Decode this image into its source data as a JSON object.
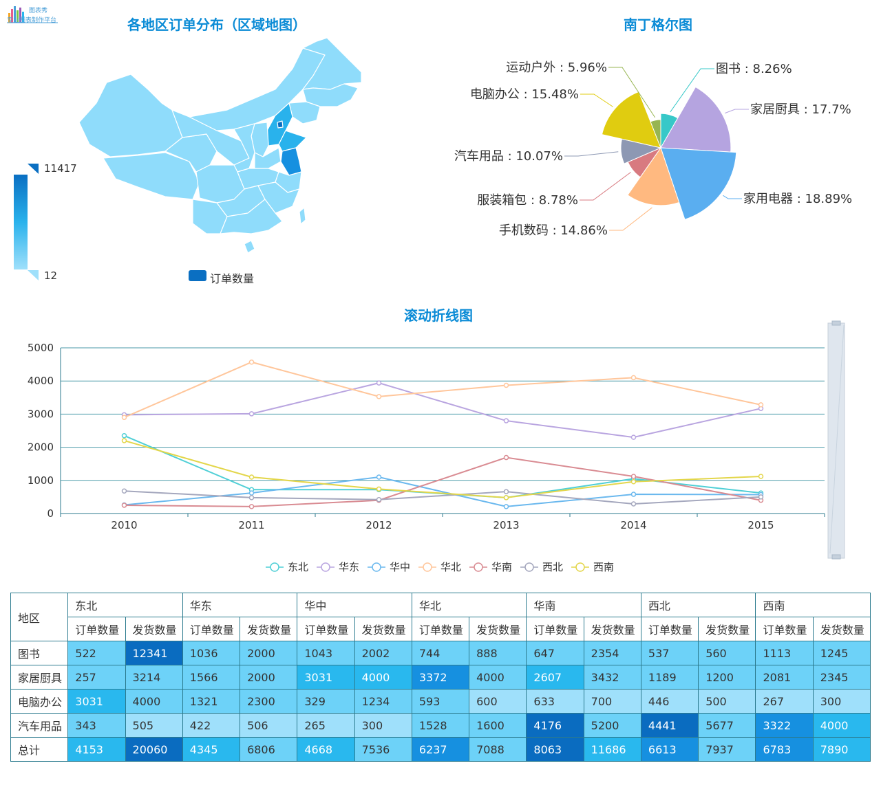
{
  "logo": {
    "brand": "图表秀",
    "tagline": "专业图表制作平台"
  },
  "map": {
    "title": "各地区订单分布（区域地图）",
    "legend_max": "11417",
    "legend_min": "12",
    "legend_label": "订单数量",
    "colors": {
      "light": "#8fdcfb",
      "mid": "#29b2ec",
      "dark": "#0a6fc2"
    }
  },
  "pie": {
    "title": "南丁格尔图",
    "slices": [
      {
        "name": "图书",
        "percent": 8.26,
        "label": "图书 : 8.26%",
        "color": "#37c8c8"
      },
      {
        "name": "家居厨具",
        "percent": 17.7,
        "label": "家居厨具 : 17.7%",
        "color": "#b5a4e0"
      },
      {
        "name": "家用电器",
        "percent": 18.89,
        "label": "家用电器 : 18.89%",
        "color": "#5aaef0"
      },
      {
        "name": "手机数码",
        "percent": 14.86,
        "label": "手机数码 : 14.86%",
        "color": "#ffb980"
      },
      {
        "name": "服装箱包",
        "percent": 8.78,
        "label": "服装箱包 : 8.78%",
        "color": "#d87a80"
      },
      {
        "name": "汽车用品",
        "percent": 10.07,
        "label": "汽车用品 : 10.07%",
        "color": "#8d98b3"
      },
      {
        "name": "电脑办公",
        "percent": 15.48,
        "label": "电脑办公 : 15.48%",
        "color": "#e0cc10"
      },
      {
        "name": "运动户外",
        "percent": 5.96,
        "label": "运动户外 : 5.96%",
        "color": "#97b552"
      }
    ]
  },
  "chart_data": {
    "type": "line",
    "title": "滚动折线图",
    "x": [
      "2010",
      "2011",
      "2012",
      "2013",
      "2014",
      "2015"
    ],
    "ylim": [
      0,
      5000
    ],
    "yticks": [
      "0",
      "1000",
      "2000",
      "3000",
      "4000",
      "5000"
    ],
    "grid": true,
    "legend": "bottom",
    "series": [
      {
        "name": "东北",
        "color": "#4fcfd6",
        "values": [
          2350,
          720,
          720,
          480,
          1050,
          620
        ]
      },
      {
        "name": "华东",
        "color": "#b9a5e0",
        "values": [
          2980,
          3010,
          3940,
          2800,
          2300,
          3170
        ]
      },
      {
        "name": "华中",
        "color": "#6ab8ee",
        "values": [
          260,
          620,
          1100,
          210,
          580,
          570
        ]
      },
      {
        "name": "华北",
        "color": "#ffc69b",
        "values": [
          2900,
          4570,
          3530,
          3870,
          4100,
          3280
        ]
      },
      {
        "name": "华南",
        "color": "#d98b92",
        "values": [
          250,
          210,
          400,
          1690,
          1120,
          400
        ]
      },
      {
        "name": "西北",
        "color": "#a4a7bd",
        "values": [
          680,
          480,
          420,
          660,
          290,
          500
        ]
      },
      {
        "name": "西南",
        "color": "#e3d64a",
        "values": [
          2200,
          1100,
          740,
          480,
          960,
          1120
        ]
      }
    ]
  },
  "table": {
    "corner": "地区",
    "regions": [
      "东北",
      "华东",
      "华中",
      "华北",
      "华南",
      "西北",
      "西南"
    ],
    "sub_headers": [
      "订单数量",
      "发货数量"
    ],
    "rows": [
      {
        "label": "图书",
        "values": [
          "522",
          "12341",
          "1036",
          "2000",
          "1043",
          "2002",
          "744",
          "888",
          "647",
          "2354",
          "537",
          "560",
          "1113",
          "1245"
        ]
      },
      {
        "label": "家居厨具",
        "values": [
          "257",
          "3214",
          "1566",
          "2000",
          "3031",
          "4000",
          "3372",
          "4000",
          "2607",
          "3432",
          "1189",
          "1200",
          "2081",
          "2345"
        ]
      },
      {
        "label": "电脑办公",
        "values": [
          "3031",
          "4000",
          "1321",
          "2300",
          "329",
          "1234",
          "593",
          "600",
          "633",
          "700",
          "446",
          "500",
          "267",
          "300"
        ]
      },
      {
        "label": "汽车用品",
        "values": [
          "343",
          "505",
          "422",
          "506",
          "265",
          "300",
          "1528",
          "1600",
          "4176",
          "5200",
          "4441",
          "5677",
          "3322",
          "4000"
        ]
      },
      {
        "label": "总计",
        "values": [
          "4153",
          "20060",
          "4345",
          "6806",
          "4668",
          "7536",
          "6237",
          "7088",
          "8063",
          "11686",
          "6613",
          "7937",
          "6783",
          "7890"
        ]
      }
    ],
    "cell_levels": [
      [
        "b",
        "e",
        "b",
        "b",
        "b",
        "b",
        "b",
        "b",
        "b",
        "b",
        "b",
        "b",
        "b",
        "b"
      ],
      [
        "b",
        "b",
        "b",
        "b",
        "c",
        "c",
        "d",
        "b",
        "c",
        "b",
        "b",
        "b",
        "b",
        "b"
      ],
      [
        "c",
        "b",
        "b",
        "b",
        "b",
        "b",
        "b",
        "a",
        "a",
        "a",
        "a",
        "a",
        "a",
        "a"
      ],
      [
        "b",
        "a",
        "a",
        "a",
        "a",
        "a",
        "b",
        "b",
        "e",
        "b",
        "e",
        "b",
        "d",
        "c"
      ],
      [
        "c",
        "e",
        "c",
        "b",
        "c",
        "b",
        "d",
        "b",
        "e",
        "c",
        "d",
        "b",
        "d",
        "c"
      ]
    ],
    "level_colors": {
      "a": "#9fe0fb",
      "b": "#6dd2f8",
      "c": "#29b8ee",
      "d": "#1690e0",
      "e": "#0a6cc0"
    }
  }
}
